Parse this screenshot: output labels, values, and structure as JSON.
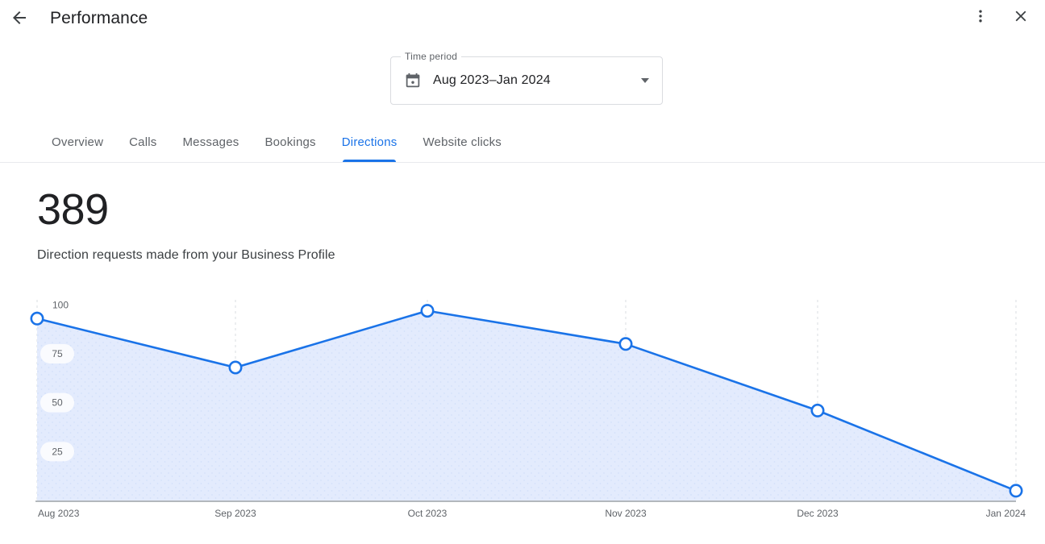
{
  "appbar": {
    "title": "Performance",
    "back_icon": "arrow-back-icon",
    "more_icon": "more-vert-icon",
    "close_icon": "close-icon"
  },
  "time_period": {
    "legend": "Time period",
    "value": "Aug 2023–Jan 2024",
    "calendar_icon": "calendar-icon",
    "dropdown_icon": "chevron-down-icon"
  },
  "tabs": [
    {
      "label": "Overview",
      "active": false
    },
    {
      "label": "Calls",
      "active": false
    },
    {
      "label": "Messages",
      "active": false
    },
    {
      "label": "Bookings",
      "active": false
    },
    {
      "label": "Directions",
      "active": true
    },
    {
      "label": "Website clicks",
      "active": false
    }
  ],
  "summary": {
    "value": "389",
    "description": "Direction requests made from your Business Profile"
  },
  "colors": {
    "accent": "#1a73e8",
    "area_fill": "#e3ebfd",
    "gridline": "#dadce0",
    "axis": "#9aa0a6",
    "text_primary": "#202124",
    "text_secondary": "#5f6368"
  },
  "chart_data": {
    "type": "area",
    "title": "",
    "xlabel": "",
    "ylabel": "",
    "categories": [
      "Aug 2023",
      "Sep 2023",
      "Oct 2023",
      "Nov 2023",
      "Dec 2023",
      "Jan 2024"
    ],
    "values": [
      93,
      68,
      97,
      80,
      46,
      5
    ],
    "series": [
      {
        "name": "Direction requests",
        "values": [
          93,
          68,
          97,
          80,
          46,
          5
        ]
      }
    ],
    "y_ticks": [
      "100",
      "75",
      "50",
      "25"
    ],
    "y_tick_values": [
      100,
      75,
      50,
      25
    ],
    "ylim": [
      0,
      103
    ],
    "grid": true,
    "grid_orientation": "vertical-dashed",
    "legend": "none",
    "markers": true,
    "line_color": "#1a73e8",
    "fill_color": "#e3ebfd"
  }
}
